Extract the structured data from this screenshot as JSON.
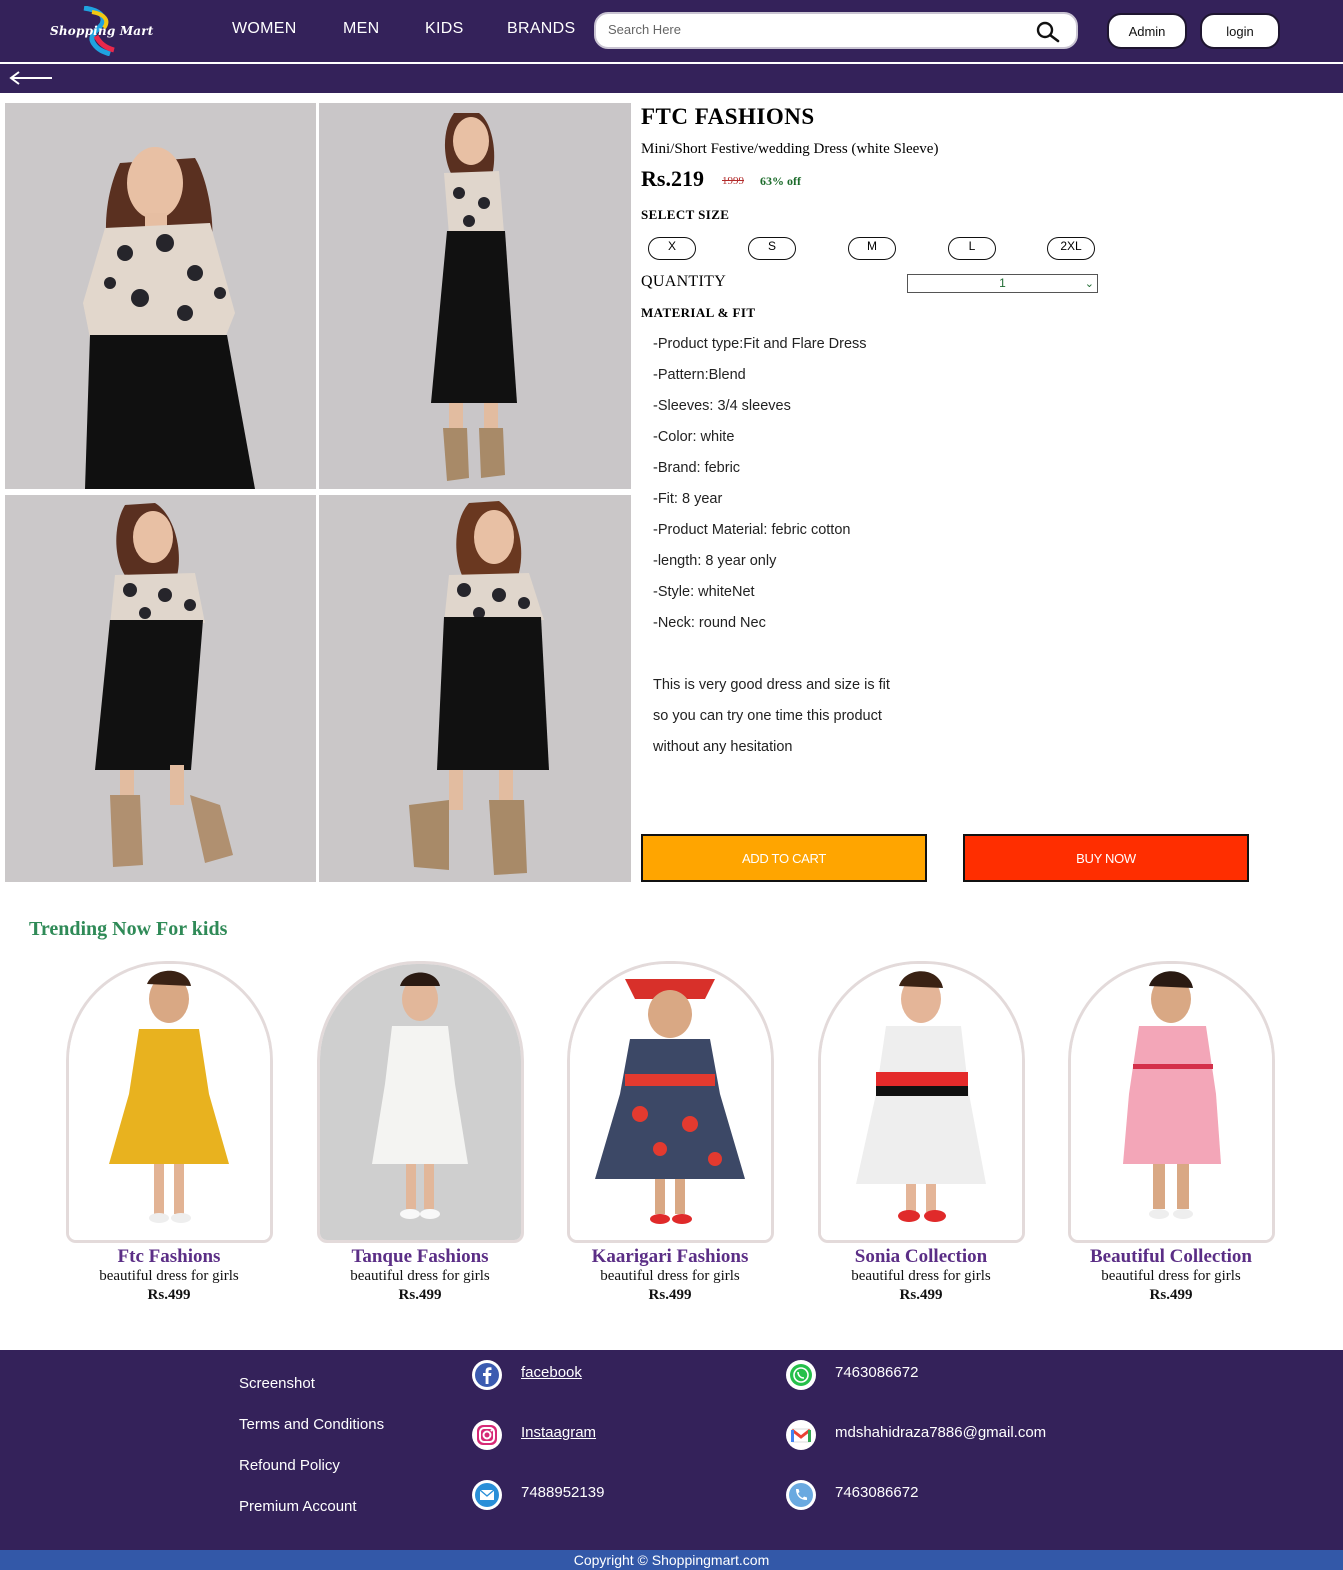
{
  "header": {
    "logo_text": "Shopping Mart",
    "nav": [
      "WOMEN",
      "MEN",
      "KIDS",
      "BRANDS"
    ],
    "search_placeholder": "Search Here",
    "admin_label": "Admin",
    "login_label": "login"
  },
  "product": {
    "brand": "FTC FASHIONS",
    "name": "Mini/Short Festive/wedding Dress (white Sleeve)",
    "price": "Rs.219",
    "mrp": "1999",
    "discount": "63% off",
    "select_size_label": "SELECT SIZE",
    "sizes": [
      "X",
      "S",
      "M",
      "L",
      "2XL"
    ],
    "quantity_label": "QUANTITY",
    "quantity_value": "1",
    "material_label": "MATERIAL & FIT",
    "specs": [
      "-Product type:Fit and Flare Dress",
      "-Pattern:Blend",
      "-Sleeves: 3/4 sleeves",
      "-Color: white",
      "-Brand: febric",
      "-Fit: 8 year",
      "-Product Material: febric cotton",
      "-length: 8 year only",
      "-Style: whiteNet",
      "-Neck: round Nec"
    ],
    "description": [
      "This is very good dress and size is fit",
      "so you can try one time this product",
      "without any hesitation"
    ],
    "add_to_cart_label": "ADD TO CART",
    "buy_now_label": "BUY NOW"
  },
  "trending": {
    "title": "Trending Now For kids",
    "items": [
      {
        "name": "Ftc Fashions",
        "desc": "beautiful dress for girls",
        "price": "Rs.499",
        "dress_color": "#e8b21f"
      },
      {
        "name": "Tanque Fashions",
        "desc": "beautiful dress for girls",
        "price": "Rs.499",
        "dress_color": "#f4f4f2"
      },
      {
        "name": "Kaarigari Fashions",
        "desc": "beautiful dress for girls",
        "price": "Rs.499",
        "dress_color": "#3c4866"
      },
      {
        "name": "Sonia Collection",
        "desc": "beautiful dress for girls",
        "price": "Rs.499",
        "dress_color": "#eeeeee"
      },
      {
        "name": "Beautiful Collection",
        "desc": "beautiful dress for girls",
        "price": "Rs.499",
        "dress_color": "#f3a6b8"
      }
    ]
  },
  "footer": {
    "links": [
      "Screenshot",
      "Terms and Conditions",
      "Refound Policy",
      "Premium Account"
    ],
    "social": [
      {
        "icon": "facebook-icon",
        "text": "facebook"
      },
      {
        "icon": "instagram-icon",
        "text": "Instaagram"
      },
      {
        "icon": "mail-icon",
        "text": "7488952139"
      }
    ],
    "contact": [
      {
        "icon": "whatsapp-icon",
        "text": "7463086672"
      },
      {
        "icon": "gmail-icon",
        "text": "mdshahidraza7886@gmail.com"
      },
      {
        "icon": "phone-icon",
        "text": "7463086672"
      }
    ],
    "copyright": "Copyright © Shoppingmart.com"
  },
  "colors": {
    "header_bg": "#34225a",
    "add_to_cart": "#ffa500",
    "buy_now": "#ff2e00",
    "trending_title": "#2f8a57",
    "card_name": "#5b2e86",
    "copyright_bar": "#3358a8"
  }
}
